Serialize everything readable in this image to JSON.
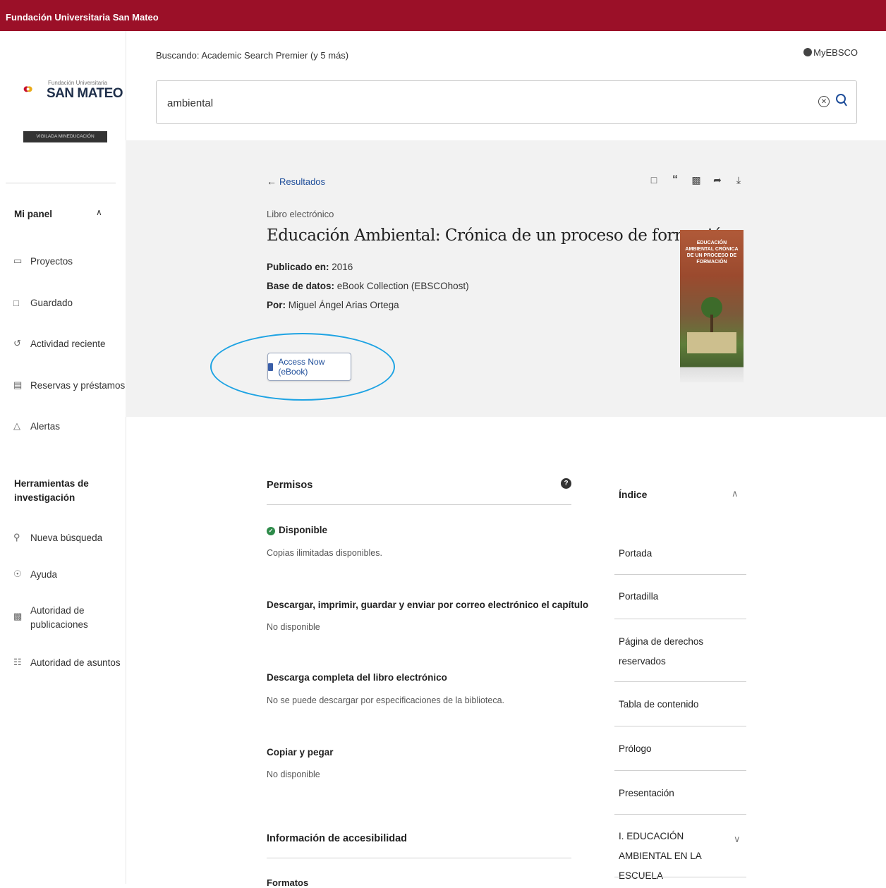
{
  "topbar": {
    "institution": "Fundación Universitaria San Mateo"
  },
  "logo": {
    "small_text": "Fundación Universitaria",
    "big_text": "SAN MATEO",
    "band_text": "VIGILADA MINEDUCACIÓN"
  },
  "sidebar": {
    "panel_title": "Mi panel",
    "panel_items": [
      {
        "label": "Proyectos",
        "icon": "folder-icon"
      },
      {
        "label": "Guardado",
        "icon": "bookmark-icon"
      },
      {
        "label": "Actividad reciente",
        "icon": "history-icon"
      },
      {
        "label": "Reservas y préstamos",
        "icon": "books-icon"
      },
      {
        "label": "Alertas",
        "icon": "bell-icon"
      }
    ],
    "tools_title_line1": "Herramientas de",
    "tools_title_line2": "investigación",
    "tool_items": [
      {
        "label": "Nueva búsqueda",
        "icon": "search-icon"
      },
      {
        "label": "Ayuda",
        "icon": "help-icon"
      },
      {
        "label_line1": "Autoridad de",
        "label_line2": "publicaciones",
        "icon": "publication-icon"
      },
      {
        "label": "Autoridad de asuntos",
        "icon": "hierarchy-icon"
      }
    ]
  },
  "search": {
    "searching_label": "Buscando:",
    "searching_value": "Academic Search Premier (y 5 más)",
    "query": "ambiental",
    "account_label": "MyEBSCO"
  },
  "record": {
    "back_label": "Resultados",
    "doc_type": "Libro electrónico",
    "title": "Educación Ambiental: Crónica de un proceso de formación",
    "published_label": "Publicado en:",
    "published_value": "2016",
    "database_label": "Base de datos:",
    "database_value": "eBook Collection (EBSCOhost)",
    "author_label": "Por:",
    "author_value": "Miguel Ángel Arias Ortega",
    "access_button": "Access Now (eBook)",
    "cover_title": "EDUCACIÓN AMBIENTAL CRÓNICA DE UN PROCESO DE FORMACIÓN"
  },
  "permissions": {
    "title": "Permisos",
    "available": "Disponible",
    "copies": "Copias ilimitadas disponibles.",
    "items": [
      {
        "heading": "Descargar, imprimir, guardar y enviar por correo electrónico el capítulo",
        "value": "No disponible"
      },
      {
        "heading": "Descarga completa del libro electrónico",
        "value": "No se puede descargar por especificaciones de la biblioteca."
      },
      {
        "heading": "Copiar y pegar",
        "value": "No disponible"
      }
    ],
    "accessibility_title": "Información de accesibilidad",
    "formats_label": "Formatos"
  },
  "toc": {
    "title": "Índice",
    "items": [
      "Portada",
      "Portadilla",
      "Página de derechos reservados",
      "Tabla de contenido",
      "Prólogo",
      "Presentación",
      "I. EDUCACIÓN AMBIENTAL EN LA ESCUELA"
    ]
  },
  "colors": {
    "brand": "#9b1028",
    "link": "#1f4e9a",
    "highlight": "#1ea3e3",
    "available": "#2e8b4a"
  }
}
